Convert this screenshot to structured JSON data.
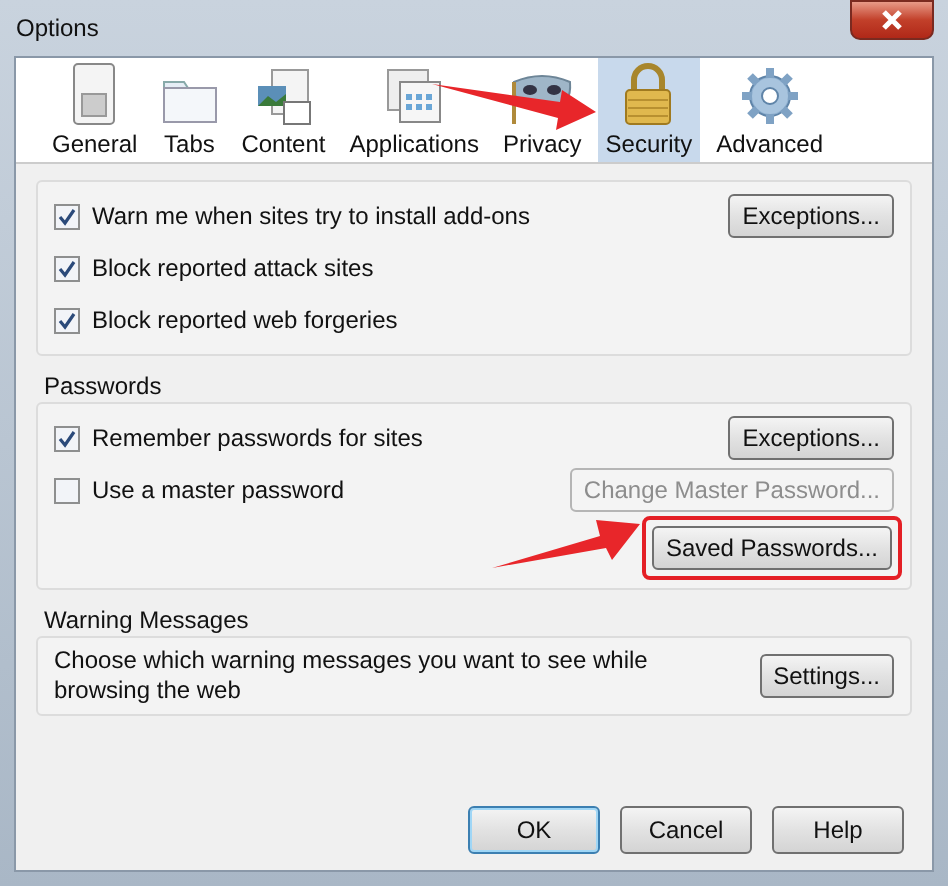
{
  "window": {
    "title": "Options"
  },
  "tabs": [
    {
      "label": "General",
      "selected": false
    },
    {
      "label": "Tabs",
      "selected": false
    },
    {
      "label": "Content",
      "selected": false
    },
    {
      "label": "Applications",
      "selected": false
    },
    {
      "label": "Privacy",
      "selected": false
    },
    {
      "label": "Security",
      "selected": true
    },
    {
      "label": "Advanced",
      "selected": false
    }
  ],
  "general_group": {
    "rows": [
      {
        "label": "Warn me when sites try to install add-ons",
        "checked": true,
        "button": "Exceptions..."
      },
      {
        "label": "Block reported attack sites",
        "checked": true
      },
      {
        "label": "Block reported web forgeries",
        "checked": true
      }
    ]
  },
  "passwords_group": {
    "title": "Passwords",
    "rows": [
      {
        "label": "Remember passwords for sites",
        "checked": true,
        "button": "Exceptions...",
        "button_disabled": false
      },
      {
        "label": "Use a master password",
        "checked": false,
        "button": "Change Master Password...",
        "button_disabled": true
      }
    ],
    "saved_button": {
      "label": "Saved Passwords...",
      "highlighted": true
    }
  },
  "warning_group": {
    "title": "Warning Messages",
    "text": "Choose which warning messages you want to see while browsing the web",
    "button": "Settings..."
  },
  "buttons": [
    {
      "label": "OK",
      "default": true
    },
    {
      "label": "Cancel",
      "default": false
    },
    {
      "label": "Help",
      "default": false
    }
  ]
}
